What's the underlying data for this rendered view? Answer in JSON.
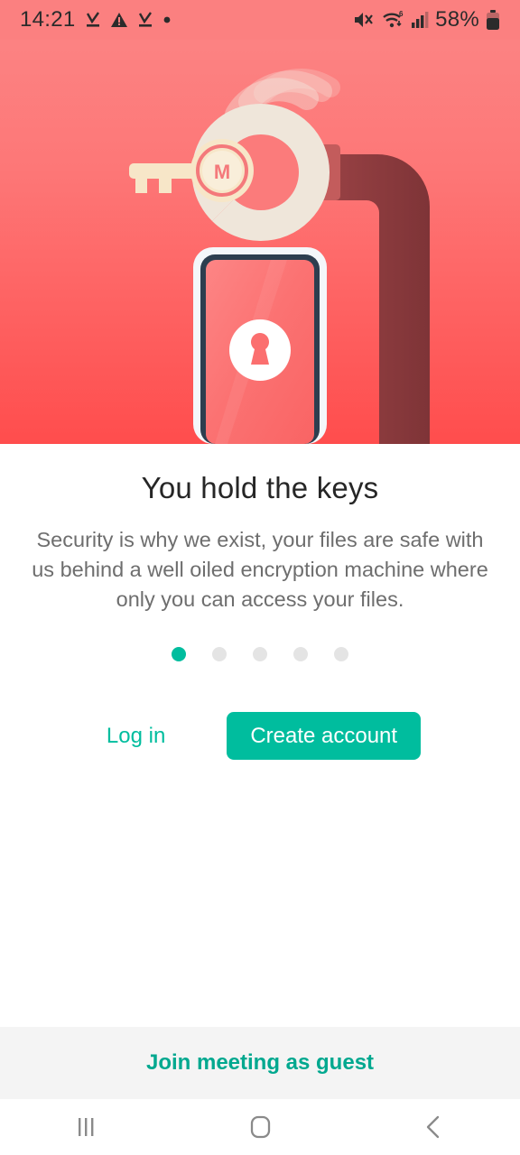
{
  "status_bar": {
    "time": "14:21",
    "battery_percent": "58%",
    "left_icons": [
      "download-done-icon",
      "warning-triangle-icon",
      "download-done-icon",
      "dot-icon"
    ],
    "right_icons": [
      "mute-icon",
      "wifi6-icon",
      "signal-bars-icon",
      "battery-icon"
    ],
    "background_color": "#FB8080"
  },
  "hero": {
    "illustration_name": "key-handcuff-phone-lock-illustration",
    "logo_letter": "M",
    "gradient_from": "#FC8686",
    "gradient_to": "#FF4D4D",
    "key_color": "#F7E6C8",
    "shackle_color": "#EFE6DA",
    "pipe_color": "#8C3B3E",
    "cuff_color": "#C35C5C",
    "phone_frame_color": "#F4F7FA",
    "phone_border_color": "#2D3E4F",
    "phone_screen_color": "#FB6F6F",
    "keyhole_circle_color": "#FFFFFF",
    "keyhole_color": "#FB6F6F"
  },
  "onboarding": {
    "title": "You hold the keys",
    "description": "Security is why we exist, your files are safe with us behind a well oiled encryption machine where only you can access your files.",
    "page_indicator": {
      "total": 5,
      "active_index": 0,
      "active_color": "#00BD9E",
      "inactive_color": "#E4E4E4"
    },
    "login_label": "Log in",
    "create_account_label": "Create account",
    "accent_color": "#00BD9E"
  },
  "footer": {
    "join_meeting_label": "Join meeting as guest",
    "background_color": "#F4F4F4",
    "link_color": "#00A88F"
  },
  "nav_bar": {
    "recents_icon": "recents-icon",
    "home_icon": "home-icon",
    "back_icon": "back-icon",
    "icon_color": "#8A8A8A"
  }
}
